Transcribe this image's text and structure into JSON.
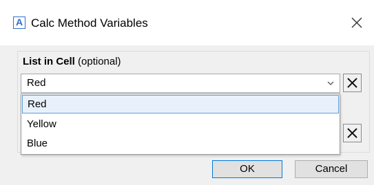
{
  "window": {
    "title": "Calc Method Variables",
    "app_icon_letter": "A",
    "accent_color": "#0078d7"
  },
  "field": {
    "label": "List in Cell",
    "optional_text": "(optional)",
    "selected_value": "Red"
  },
  "dropdown": {
    "options": [
      "Red",
      "Yellow",
      "Blue"
    ],
    "highlighted_index": 0
  },
  "buttons": {
    "ok_label": "OK",
    "cancel_label": "Cancel"
  },
  "icons": {
    "close": "close-icon",
    "chevron": "chevron-down-icon",
    "clear": "clear-x-icon"
  }
}
